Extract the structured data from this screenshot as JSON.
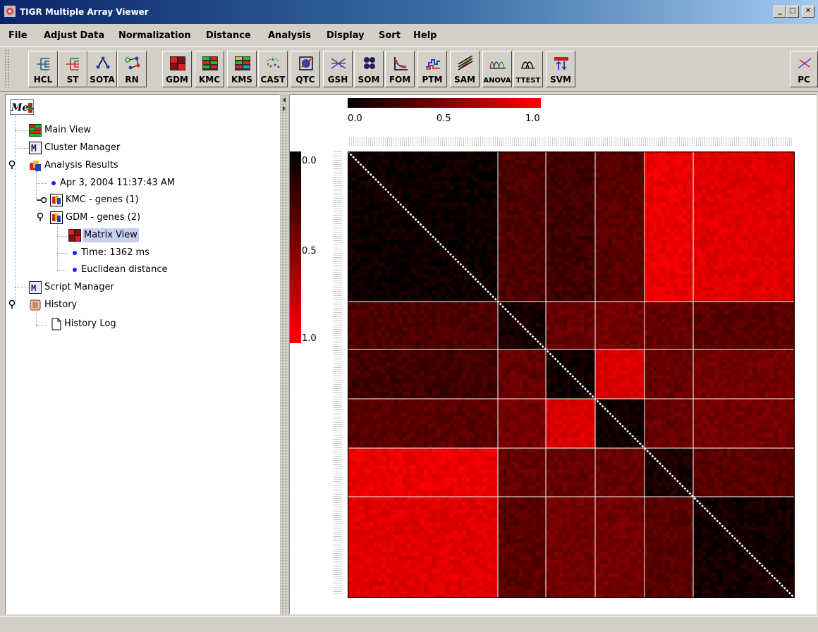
{
  "window": {
    "title": "TIGR Multiple Array Viewer",
    "controls": [
      "minimize-button",
      "maximize-button",
      "close-button"
    ],
    "control_glyphs": [
      "_",
      "□",
      "✕"
    ]
  },
  "menu": [
    "File",
    "Adjust Data",
    "Normalization",
    "Distance",
    "Analysis",
    "Display",
    "Sort",
    "Help"
  ],
  "toolbar": [
    {
      "label": "HCL",
      "icon": "hierarchical-tree-icon"
    },
    {
      "label": "ST",
      "icon": "support-tree-icon"
    },
    {
      "label": "SOTA",
      "icon": "sota-tree-icon"
    },
    {
      "label": "RN",
      "icon": "relevance-network-icon"
    },
    {
      "label": "GDM",
      "icon": "distance-matrix-icon"
    },
    {
      "label": "KMC",
      "icon": "kmeans-icon"
    },
    {
      "label": "KMS",
      "icon": "kmeans-support-icon"
    },
    {
      "label": "CAST",
      "icon": "cast-icon"
    },
    {
      "label": "QTC",
      "icon": "qt-cluster-icon"
    },
    {
      "label": "GSH",
      "icon": "gene-shaving-icon"
    },
    {
      "label": "SOM",
      "icon": "som-icon"
    },
    {
      "label": "FOM",
      "icon": "figure-of-merit-icon"
    },
    {
      "label": "PTM",
      "icon": "template-matching-icon"
    },
    {
      "label": "SAM",
      "icon": "sam-icon"
    },
    {
      "label": "ANOVA",
      "icon": "anova-icon"
    },
    {
      "label": "TTEST",
      "icon": "ttest-icon"
    },
    {
      "label": "SVM",
      "icon": "svm-icon"
    },
    {
      "label": "PC",
      "icon": "pca-icon"
    }
  ],
  "tree": {
    "root_label": "MeV",
    "main_view": "Main View",
    "cluster_manager": "Cluster Manager",
    "analysis_results": "Analysis Results",
    "timestamp": "Apr 3, 2004 11:37:43 AM",
    "kmc": "KMC - genes (1)",
    "gdm": "GDM - genes (2)",
    "matrix_view": "Matrix View",
    "time": "Time: 1362 ms",
    "distance": "Euclidean distance",
    "script_manager": "Script Manager",
    "history": "History",
    "history_log": "History Log"
  },
  "colors": {
    "low": "#000000",
    "high": "#ff0000",
    "separator": "#ffffff",
    "diagonal": "#ffffff"
  },
  "color_scale": {
    "horizontal_ticks": [
      "0.0",
      "0.5",
      "1.0"
    ],
    "vertical_ticks": [
      "0.0",
      "0.5",
      "1.0"
    ]
  },
  "chart_data": {
    "type": "heatmap",
    "value_range": [
      0,
      1
    ],
    "cluster_blocks": [
      "1",
      "2",
      "3",
      "4",
      "5",
      "6"
    ],
    "block_values": [
      [
        0.05,
        0.3,
        0.25,
        0.35,
        0.92,
        0.88
      ],
      [
        0.3,
        0.08,
        0.4,
        0.45,
        0.4,
        0.35
      ],
      [
        0.25,
        0.4,
        0.06,
        0.85,
        0.4,
        0.45
      ],
      [
        0.35,
        0.45,
        0.85,
        0.06,
        0.4,
        0.45
      ],
      [
        0.92,
        0.4,
        0.4,
        0.4,
        0.1,
        0.35
      ],
      [
        0.88,
        0.35,
        0.45,
        0.45,
        0.35,
        0.08
      ]
    ]
  }
}
